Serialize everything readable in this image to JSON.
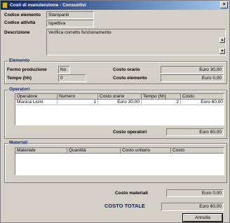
{
  "window": {
    "title": "Costi di manutenzione - Consuntivi",
    "close": "×"
  },
  "header": {
    "codice_elemento_label": "Codice elemento",
    "codice_elemento_value": "Stampanti",
    "codice_attivita_label": "Codice attività",
    "codice_attivita_value": "Ispettiva",
    "descrizione_label": "Descrizione",
    "descrizione_value": "Verifica corretto funzionamento"
  },
  "elemento": {
    "legend": "Elemento",
    "fermo_label": "Fermo produzione",
    "fermo_value": "No",
    "tempo_label": "Tempo (hh)",
    "tempo_value": "0",
    "costo_orario_label": "Costo orario",
    "costo_orario_value": "Euro 30,00",
    "costo_elemento_label": "Costo elemento",
    "costo_elemento_value": "Euro 0,00"
  },
  "operatori": {
    "legend": "Operatori",
    "columns": [
      "Operatore",
      "Numero",
      "Costo orario",
      "Tempo (hh)",
      "Costo"
    ],
    "rows": [
      {
        "operatore": "Monica Licini",
        "numero": "1",
        "costo_orario": "Euro 30,00",
        "tempo": "2",
        "costo": "Euro 60,00"
      }
    ],
    "costo_label": "Costo operatori",
    "costo_value": "Euro 60,00"
  },
  "materiali": {
    "legend": "Materiali",
    "columns": [
      "Materiale",
      "Quantità",
      "Costo unitario",
      "Costo"
    ],
    "costo_label": "Costo materiali",
    "costo_value": "Euro 0,00"
  },
  "totale": {
    "label": "COSTO TOTALE",
    "value": "Euro 60,00"
  },
  "footer": {
    "annulla": "Annulla"
  },
  "icons": {
    "window": "app-icon",
    "scroll_up": "scroll-up-icon",
    "scroll_down": "scroll-down-icon"
  },
  "colors": {
    "title_start": "#0a246a",
    "title_end": "#a6caf0",
    "face": "#d4d0c8",
    "legend": "#0a246a"
  }
}
